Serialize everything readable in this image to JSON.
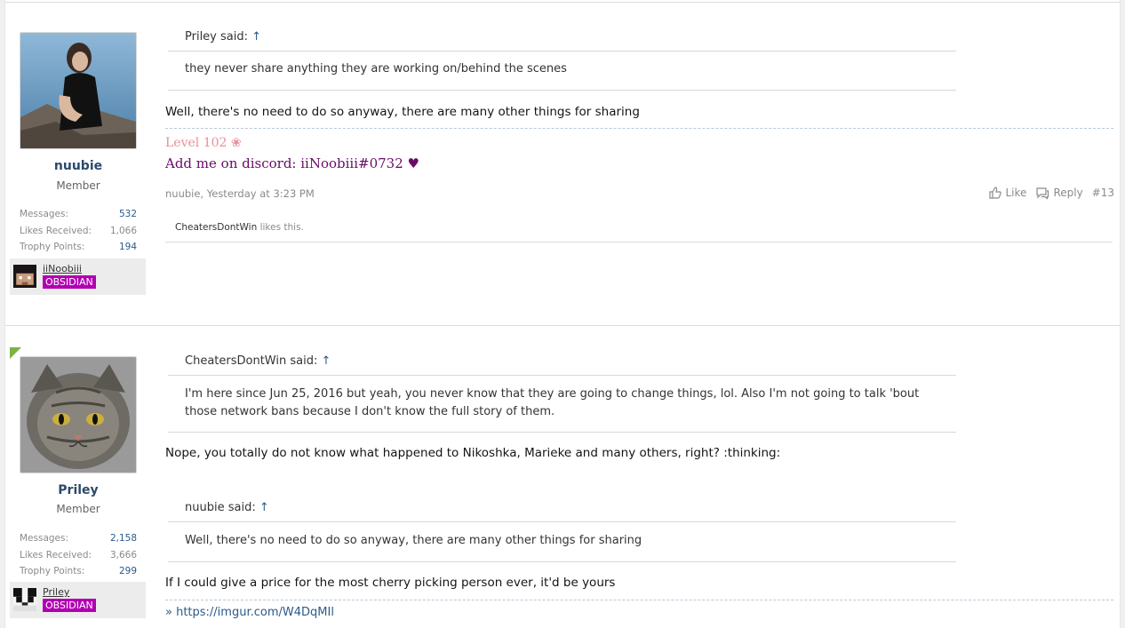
{
  "posts": [
    {
      "author": "nuubie",
      "user_title": "Member",
      "stats": [
        {
          "label": "Messages:",
          "value": "532"
        },
        {
          "label": "Likes Received:",
          "value": "1,066"
        },
        {
          "label": "Trophy Points:",
          "value": "194"
        }
      ],
      "mc_name": "iiNoobiii",
      "mc_rank": "OBSIDIAN",
      "quote": {
        "name": "Priley said:",
        "arrow": "↑",
        "text": "they never share anything they are working on/behind the scenes"
      },
      "body": "Well, there's no need to do so anyway, there are many other things for sharing",
      "signature": {
        "level": "Level 102 ❀",
        "discord": "Add me on discord: iiNoobiii#0732 ♥"
      },
      "meta": "nuubie, Yesterday at 3:23 PM",
      "actions": {
        "like": "Like",
        "reply": "Reply",
        "number": "#13"
      },
      "likes": {
        "who": "CheatersDontWin",
        "rest": " likes this."
      }
    },
    {
      "author": "Priley",
      "user_title": "Member",
      "stats": [
        {
          "label": "Messages:",
          "value": "2,158"
        },
        {
          "label": "Likes Received:",
          "value": "3,666"
        },
        {
          "label": "Trophy Points:",
          "value": "299"
        }
      ],
      "mc_name": "Priley",
      "mc_rank": "OBSIDIAN",
      "quote1": {
        "name": "CheatersDontWin said:",
        "arrow": "↑",
        "text": "I'm here since Jun 25, 2016 but yeah, you never know that they are going to change things, lol. Also I'm not going to talk 'bout those network bans because I don't know the full story of them."
      },
      "body1": "Nope, you totally do not know what happened to Nikoshka, Marieke and many others, right? :thinking:",
      "quote2": {
        "name": "nuubie said:",
        "arrow": "↑",
        "text": "Well, there's no need to do so anyway, there are many other things for sharing"
      },
      "body2": "If I could give a price for the most cherry picking person ever, it'd be yours",
      "link": "» https://imgur.com/W4DqMIl"
    }
  ]
}
